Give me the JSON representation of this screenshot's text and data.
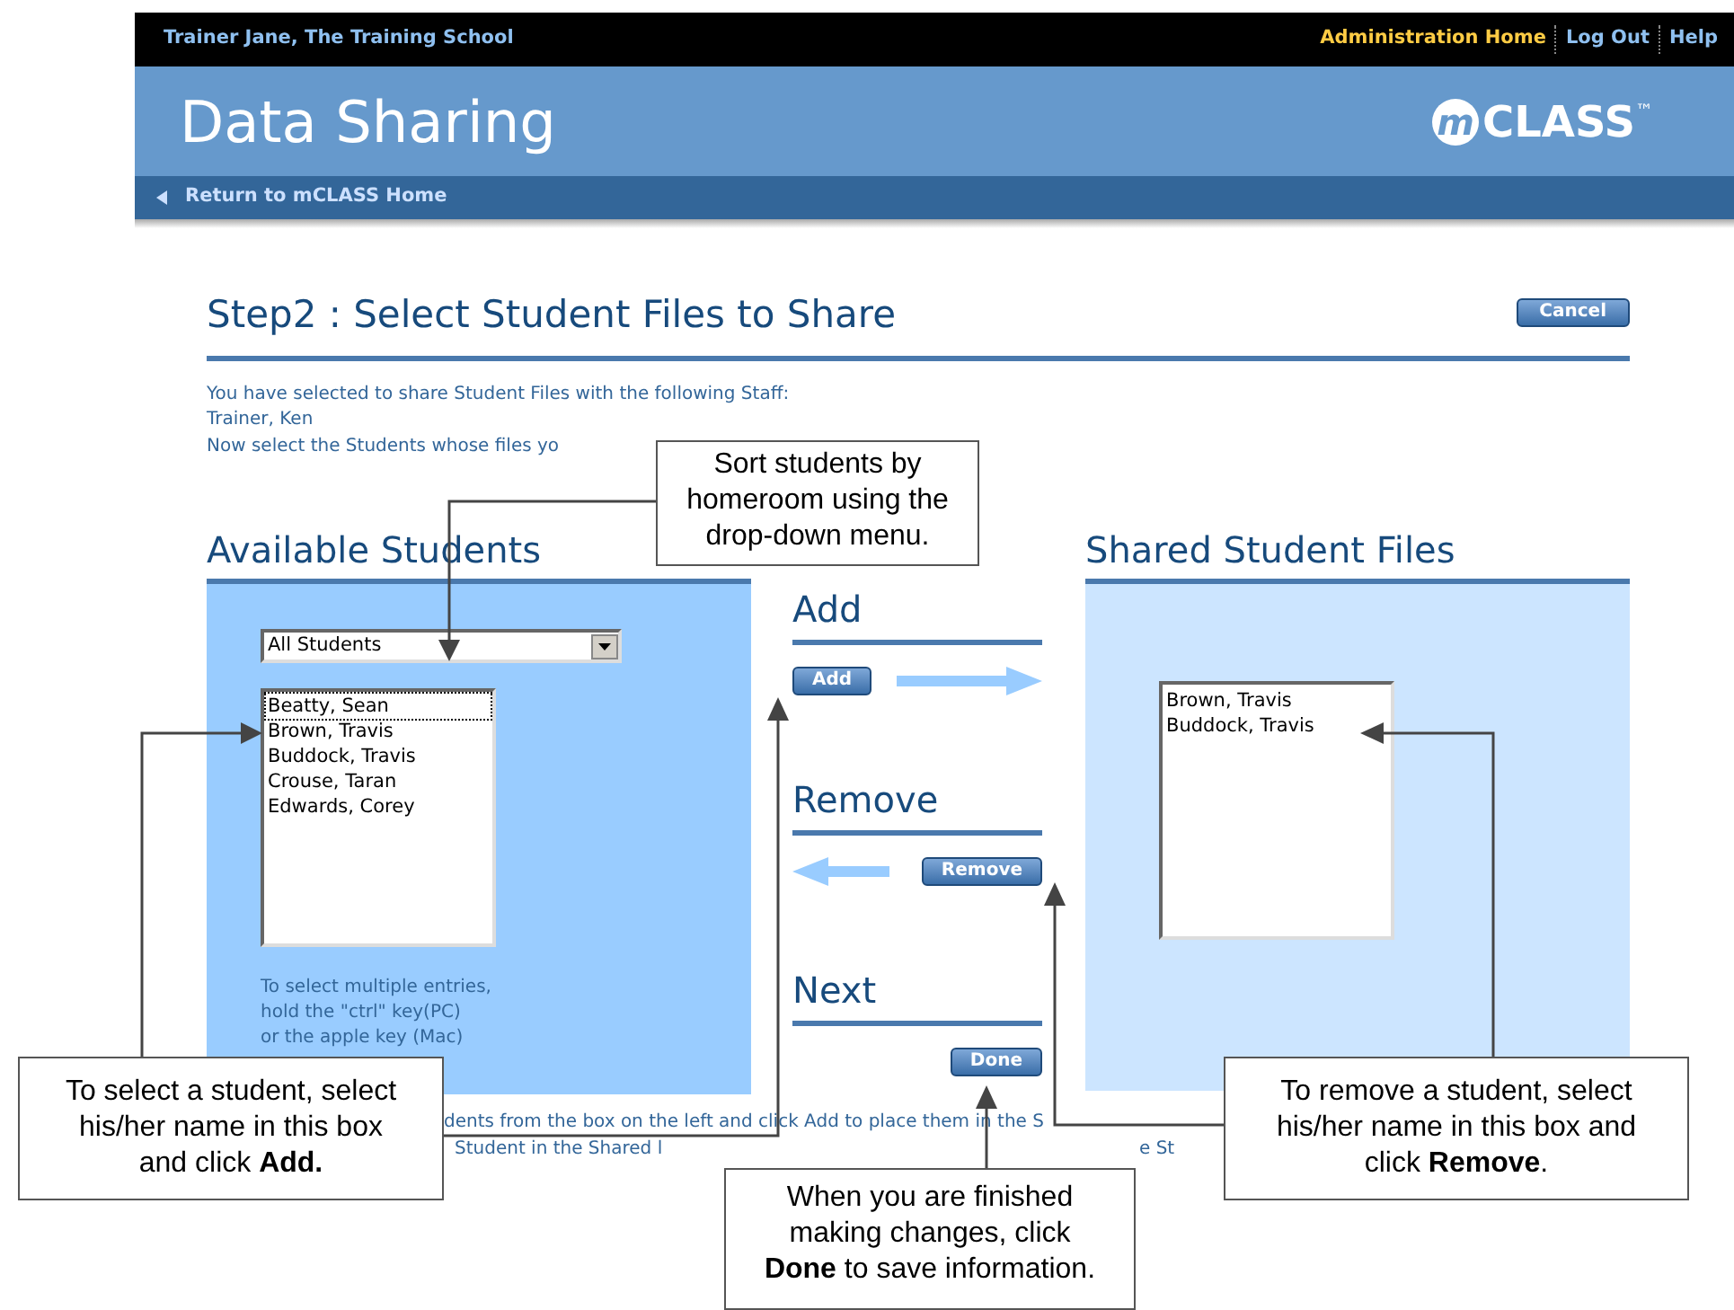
{
  "top_bar": {
    "user": "Trainer Jane, The Training School",
    "links": [
      {
        "label": "Administration Home",
        "selected": true
      },
      {
        "label": "Log Out",
        "selected": false
      },
      {
        "label": "Help",
        "selected": false
      }
    ]
  },
  "header": {
    "title": "Data Sharing",
    "logo_mark": "m",
    "logo_text": "CLASS",
    "trademark": "™"
  },
  "return_link": "Return to mCLASS Home",
  "page": {
    "title": "Step2 : Select Student Files to Share",
    "cancel": "Cancel",
    "intro": [
      "You have selected to share Student Files with the following Staff:",
      "Trainer, Ken",
      "Now select the Students whose files yo"
    ]
  },
  "available": {
    "heading": "Available Students",
    "filter": "All Students",
    "students": [
      {
        "name": "Beatty, Sean",
        "focused": true
      },
      {
        "name": "Brown, Travis",
        "focused": false
      },
      {
        "name": "Buddock, Travis",
        "focused": false
      },
      {
        "name": "Crouse, Taran",
        "focused": false
      },
      {
        "name": "Edwards, Corey",
        "focused": false
      }
    ],
    "hint": [
      "To select multiple entries,",
      "hold the \"ctrl\" key(PC)",
      "or the apple key (Mac)"
    ]
  },
  "actions": [
    {
      "heading": "Add",
      "button": "Add",
      "kind": "add"
    },
    {
      "heading": "Remove",
      "button": "Remove",
      "kind": "remove"
    },
    {
      "heading": "Next",
      "button": "Done",
      "kind": "next"
    }
  ],
  "shared": {
    "heading": "Shared Student Files",
    "students": [
      "Brown, Travis",
      "Buddock, Travis"
    ]
  },
  "footer_lines": [
    [
      "dents from the box on the left and click Add to place them in the S"
    ],
    [
      "Student in the Shared l",
      "e St"
    ]
  ],
  "callouts": [
    {
      "text": "Sort students by homeroom using the drop-down menu."
    },
    {
      "text": "To select a student, select his/her name in this box and click **Add.**"
    },
    {
      "text": "When you are finished making changes, click **Done** to save information."
    },
    {
      "text": "To remove a student, select his/her name in this box and click **Remove**."
    }
  ]
}
